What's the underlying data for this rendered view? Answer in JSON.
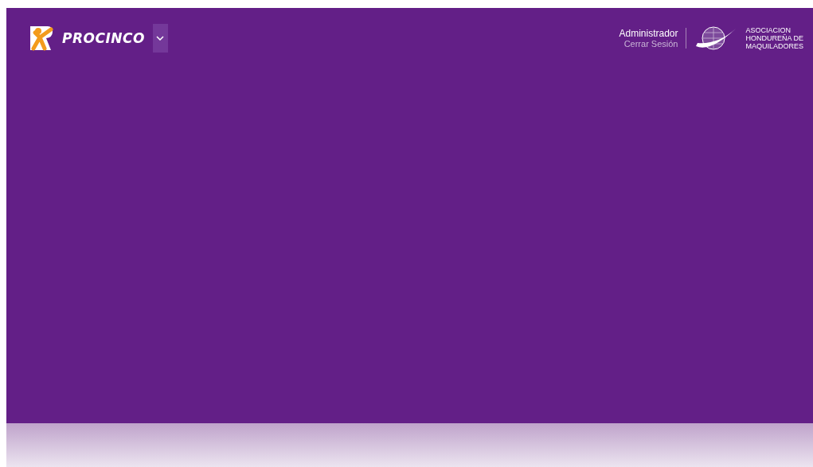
{
  "header": {
    "brand": "PROCINCO",
    "user": {
      "name": "Administrador",
      "logout": "Cerrar Sesión"
    },
    "partner_logo": [
      "ASOCIACION",
      "HONDUREÑA DE",
      "MAQUILADORES"
    ]
  }
}
